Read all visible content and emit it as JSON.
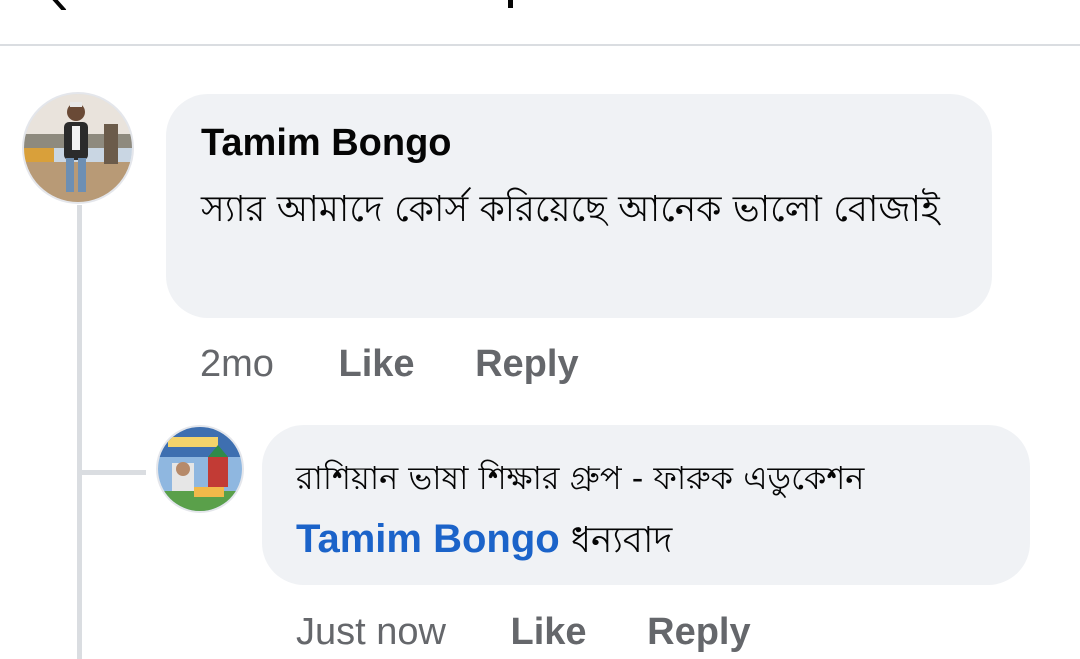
{
  "comments": [
    {
      "author": "Tamim Bongo",
      "text": "স্যার আমাদে কোর্স করিয়েছে আনেক ভালো বোজাই",
      "time": "2mo",
      "like_label": "Like",
      "reply_label": "Reply"
    }
  ],
  "replies": [
    {
      "author": "রাশিয়ান ভাষা শিক্ষার গ্রুপ - ফারুক এডুকেশন",
      "mention": "Tamim Bongo",
      "text": "ধন্যবাদ",
      "time": "Just now",
      "like_label": "Like",
      "reply_label": "Reply"
    }
  ],
  "colors": {
    "bubble": "#f0f2f5",
    "mention": "#1b63c9",
    "secondary_text": "#65676b",
    "thread_line": "#dadde1"
  },
  "icons": {
    "header_left": "back-arrow-icon",
    "header_right": "search-icon"
  }
}
